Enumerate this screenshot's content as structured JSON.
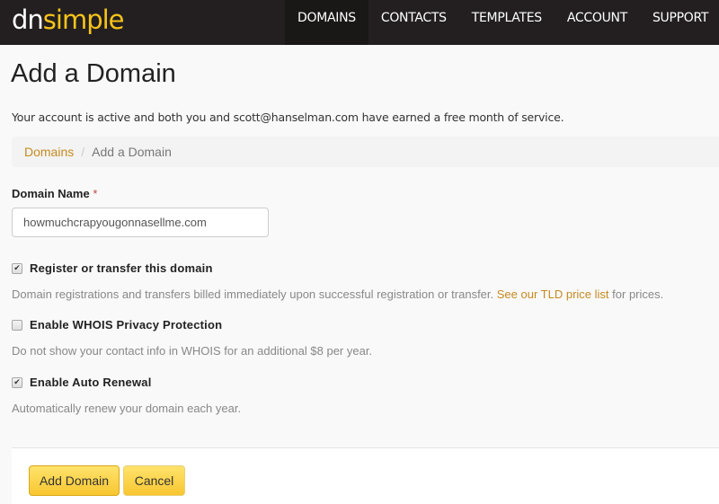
{
  "brand": {
    "logo_part1": "dn",
    "logo_part2": "simple"
  },
  "nav": {
    "items": [
      {
        "label": "DOMAINS",
        "active": true
      },
      {
        "label": "CONTACTS"
      },
      {
        "label": "TEMPLATES"
      },
      {
        "label": "ACCOUNT"
      },
      {
        "label": "SUPPORT"
      }
    ]
  },
  "page": {
    "title": "Add a Domain",
    "notice": "Your account is active and both you and scott@hanselman.com have earned a free month of service."
  },
  "breadcrumb": {
    "parent": "Domains",
    "separator": "/",
    "current": "Add a Domain"
  },
  "form": {
    "domain_label": "Domain Name",
    "required_mark": "*",
    "domain_value": "howmuchcrapyougonnasellme.com",
    "options": [
      {
        "label": "Register or transfer this domain",
        "checked": true,
        "help": "Domain registrations and transfers billed immediately upon successful registration or transfer.",
        "help_link": "See our TLD price list",
        "help_tail": "for prices."
      },
      {
        "label": "Enable WHOIS Privacy Protection",
        "checked": false,
        "help": "Do not show your contact info in WHOIS for an additional $8 per year."
      },
      {
        "label": "Enable Auto Renewal",
        "checked": true,
        "help": "Automatically renew your domain each year."
      }
    ],
    "submit_label": "Add Domain",
    "cancel_label": "Cancel"
  },
  "colors": {
    "navbar": "#231f20",
    "brand_yellow": "#f6c31a",
    "link": "#c58a20",
    "button": "#f8c630"
  }
}
